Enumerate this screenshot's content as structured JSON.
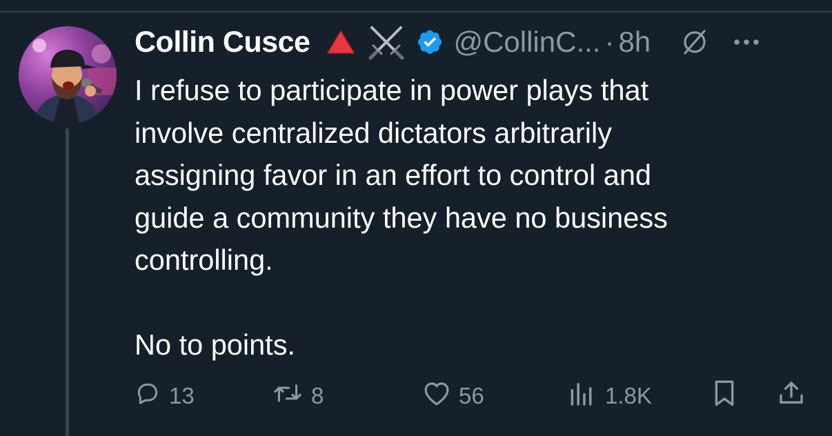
{
  "tweet": {
    "author": {
      "display_name": "Collin Cusce",
      "badges": [
        "red-triangle-emoji",
        "crossed-swords-emoji",
        "verified-badge"
      ],
      "handle": "@CollinC...",
      "separator": "·",
      "time": "8h"
    },
    "text": "I refuse to participate in power plays that\ninvolve centralized dictators arbitrarily\nassigning favor in an effort to control and\nguide a community they have no business\ncontrolling.\n\nNo to points.",
    "actions": {
      "replies": "13",
      "retweets": "8",
      "likes": "56",
      "views": "1.8K"
    }
  },
  "colors": {
    "background": "#15202b",
    "text_primary": "#ffffff",
    "text_secondary": "#8b98a5",
    "divider": "#38444d",
    "verified": "#1d9bf0",
    "red_triangle": "#e8383d"
  },
  "icons": {
    "grok": "grok-icon",
    "more": "more-icon",
    "reply": "reply-icon",
    "retweet": "retweet-icon",
    "like": "heart-icon",
    "views": "views-icon",
    "bookmark": "bookmark-icon",
    "share": "share-icon"
  }
}
